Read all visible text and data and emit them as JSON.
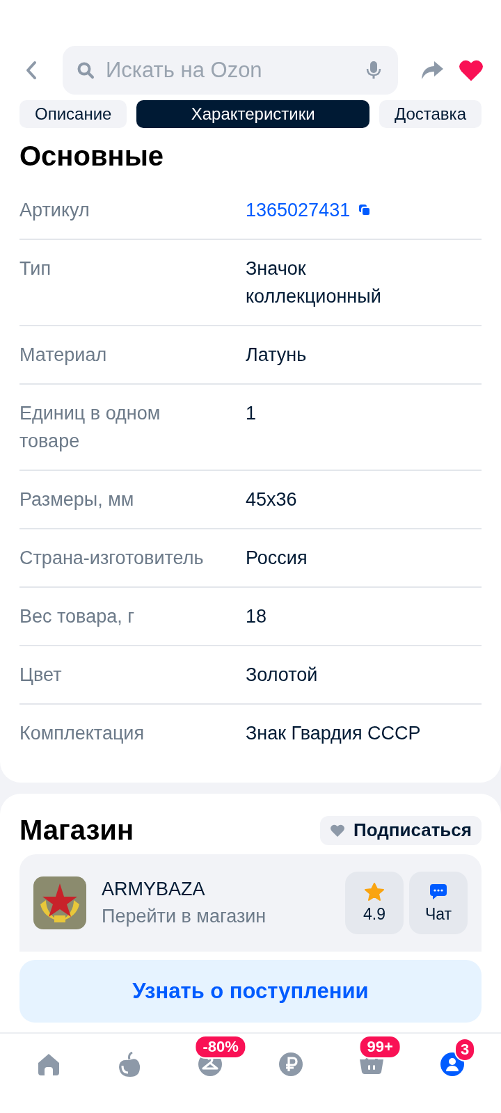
{
  "header": {
    "search": {
      "placeholder": "Искать на Ozon"
    },
    "favorite": true
  },
  "tabs": [
    {
      "label": "Описание",
      "selected": false
    },
    {
      "label": "Характеристики",
      "selected": true
    },
    {
      "label": "Доставка",
      "selected": false
    }
  ],
  "specs": {
    "title": "Основные",
    "rows": [
      {
        "label": "Артикул",
        "value": "1365027431",
        "kind": "link"
      },
      {
        "label": "Тип",
        "value": "Значок коллекционный",
        "kind": "text"
      },
      {
        "label": "Материал",
        "value": "Латунь",
        "kind": "text"
      },
      {
        "label": "Единиц в одном товаре",
        "value": "1",
        "kind": "text"
      },
      {
        "label": "Размеры, мм",
        "value": "45x36",
        "kind": "text"
      },
      {
        "label": "Страна-изготовитель",
        "value": "Россия",
        "kind": "text"
      },
      {
        "label": "Вес товара, г",
        "value": "18",
        "kind": "text"
      },
      {
        "label": "Цвет",
        "value": "Золотой",
        "kind": "text"
      },
      {
        "label": "Комплектация",
        "value": "Знак Гвардия СССР",
        "kind": "text"
      }
    ]
  },
  "shop": {
    "title": "Магазин",
    "subscribe": "Подписаться",
    "name": "ARMYBAZA",
    "link": "Перейти в магазин",
    "rating": "4.9",
    "chat": "Чат"
  },
  "notify_button": "Узнать о поступлении",
  "bottom_nav": [
    {
      "kind": "home",
      "selected": false
    },
    {
      "kind": "fresh",
      "selected": false
    },
    {
      "kind": "fashion",
      "selected": false,
      "badge": "-80%"
    },
    {
      "kind": "finance",
      "selected": false
    },
    {
      "kind": "cart",
      "selected": false,
      "badge": "99+"
    },
    {
      "kind": "profile",
      "selected": true,
      "badge": "3"
    }
  ]
}
